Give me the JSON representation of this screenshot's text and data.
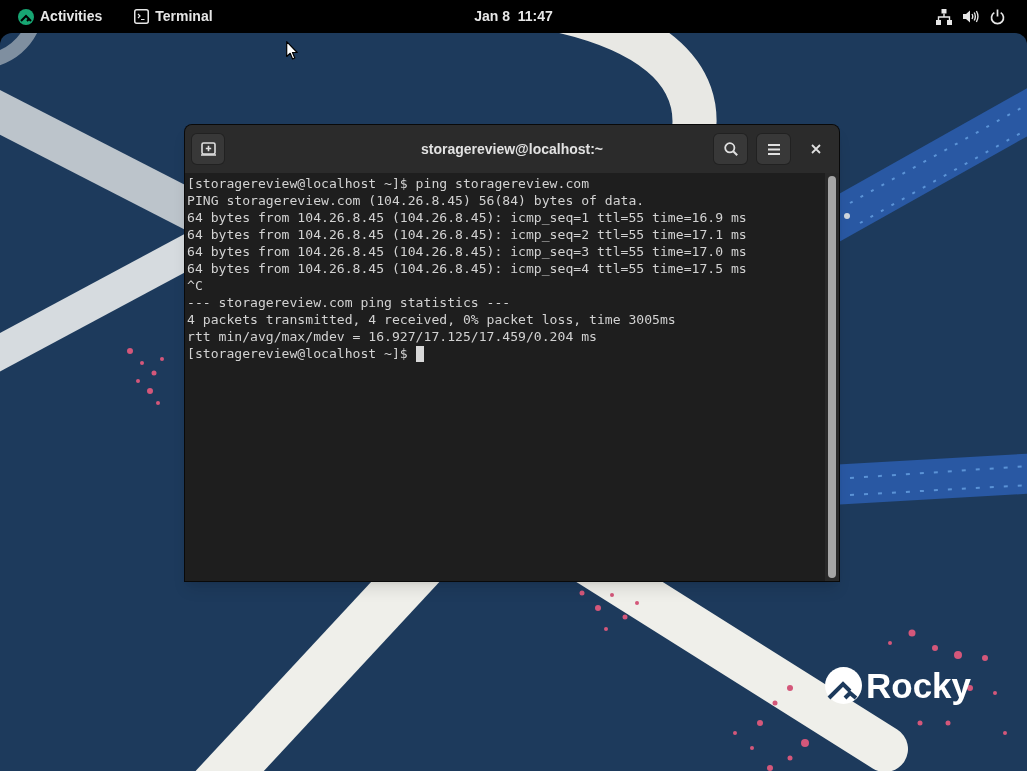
{
  "top_bar": {
    "activities": "Activities",
    "app_menu": "Terminal",
    "clock": "Jan 8  11:47"
  },
  "terminal": {
    "title": "storagereview@localhost:~",
    "lines": [
      "[storagereview@localhost ~]$ ping storagereview.com",
      "PING storagereview.com (104.26.8.45) 56(84) bytes of data.",
      "64 bytes from 104.26.8.45 (104.26.8.45): icmp_seq=1 ttl=55 time=16.9 ms",
      "64 bytes from 104.26.8.45 (104.26.8.45): icmp_seq=2 ttl=55 time=17.1 ms",
      "64 bytes from 104.26.8.45 (104.26.8.45): icmp_seq=3 ttl=55 time=17.0 ms",
      "64 bytes from 104.26.8.45 (104.26.8.45): icmp_seq=4 ttl=55 time=17.5 ms",
      "^C",
      "--- storagereview.com ping statistics ---",
      "4 packets transmitted, 4 received, 0% packet loss, time 3005ms",
      "rtt min/avg/max/mdev = 16.927/17.125/17.459/0.204 ms"
    ],
    "prompt": "[storagereview@localhost ~]$"
  },
  "desktop": {
    "logo_text": "Rocky"
  }
}
